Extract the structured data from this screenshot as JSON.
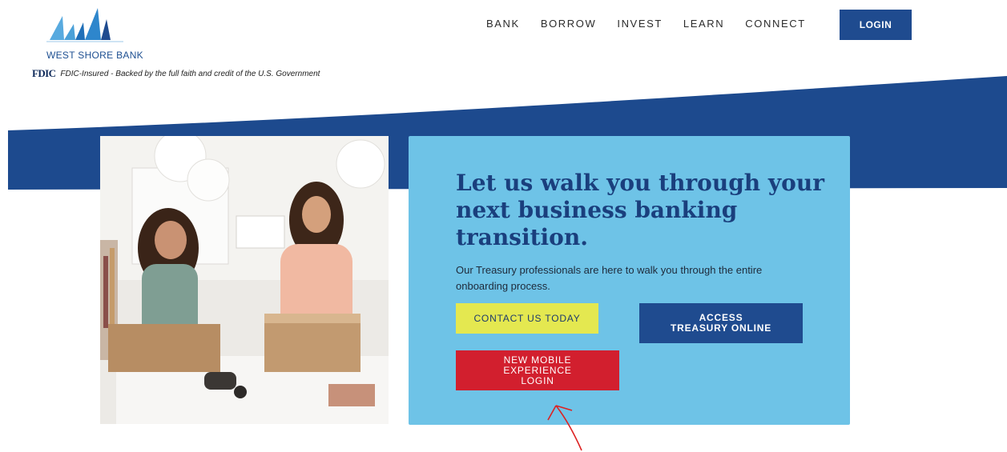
{
  "brand": {
    "name": "WEST SHORE BANK",
    "fdic_mark": "FDIC",
    "fdic_text": "FDIC-Insured - Backed by the full faith and credit of the U.S. Government",
    "colors": {
      "navy": "#1f4b8f",
      "sky": "#6ec3e7",
      "yellow": "#e4e850",
      "red": "#d21f2e"
    }
  },
  "nav": {
    "items": [
      "BANK",
      "BORROW",
      "INVEST",
      "LEARN",
      "CONNECT"
    ],
    "login_label": "LOGIN"
  },
  "hero": {
    "heading": "Let us walk you through your next business banking transition.",
    "body": "Our Treasury professionals are here to walk you through the entire onboarding process.",
    "contact_label": "CONTACT US TODAY",
    "treasury_label": "ACCESS TREASURY ONLINE",
    "mobile_label": "NEW MOBILE EXPERIENCE LOGIN"
  }
}
